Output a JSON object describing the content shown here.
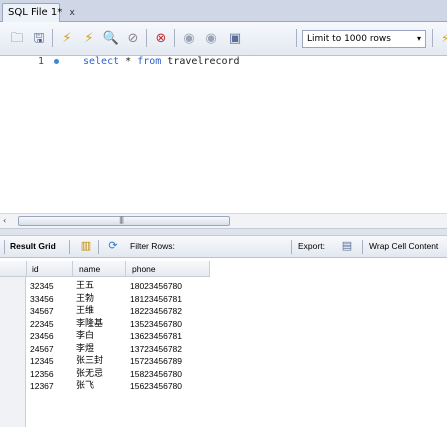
{
  "tab": {
    "label": "SQL File 1*",
    "close": "x"
  },
  "toolbar": {
    "buttons": [
      {
        "name": "open-folder-icon",
        "glyph": "🗀"
      },
      {
        "name": "save-icon",
        "glyph": "🖫"
      },
      {
        "name": "execute-icon",
        "glyph": "⚡"
      },
      {
        "name": "execute-current-icon",
        "glyph": "⚡"
      },
      {
        "name": "explain-icon",
        "glyph": "🔍"
      },
      {
        "name": "stop-icon",
        "glyph": "⊘"
      },
      {
        "name": "toggle-autocommit-icon",
        "glyph": "⊗"
      },
      {
        "name": "commit-icon",
        "glyph": "◉"
      },
      {
        "name": "rollback-icon",
        "glyph": "◉"
      },
      {
        "name": "beautify-icon",
        "glyph": "▣"
      }
    ],
    "limit_label": "Limit to 1000 rows",
    "limit_arrow": "▾"
  },
  "editor": {
    "line_number": "1",
    "code": {
      "kw1": "select",
      "star": " * ",
      "kw2": "from",
      "table": " travelrecord"
    }
  },
  "scrollbar": {
    "left_arrow": "‹",
    "grip": "|||"
  },
  "result_toolbar": {
    "result_grid": "Result Grid",
    "filter_rows": "Filter Rows:",
    "export": "Export:",
    "wrap_cell": "Wrap Cell Content"
  },
  "grid": {
    "columns": [
      "id",
      "name",
      "phone"
    ],
    "rows": [
      {
        "id": "32345",
        "name": "王五",
        "phone": "18023456780"
      },
      {
        "id": "33456",
        "name": "王勃",
        "phone": "18123456781"
      },
      {
        "id": "34567",
        "name": "王维",
        "phone": "18223456782"
      },
      {
        "id": "22345",
        "name": "李隆基",
        "phone": "13523456780"
      },
      {
        "id": "23456",
        "name": "李白",
        "phone": "13623456781"
      },
      {
        "id": "24567",
        "name": "李煜",
        "phone": "13723456782"
      },
      {
        "id": "12345",
        "name": "张三封",
        "phone": "15723456789"
      },
      {
        "id": "12356",
        "name": "张无忌",
        "phone": "15823456780"
      },
      {
        "id": "12367",
        "name": "张飞",
        "phone": "15623456780"
      }
    ]
  }
}
